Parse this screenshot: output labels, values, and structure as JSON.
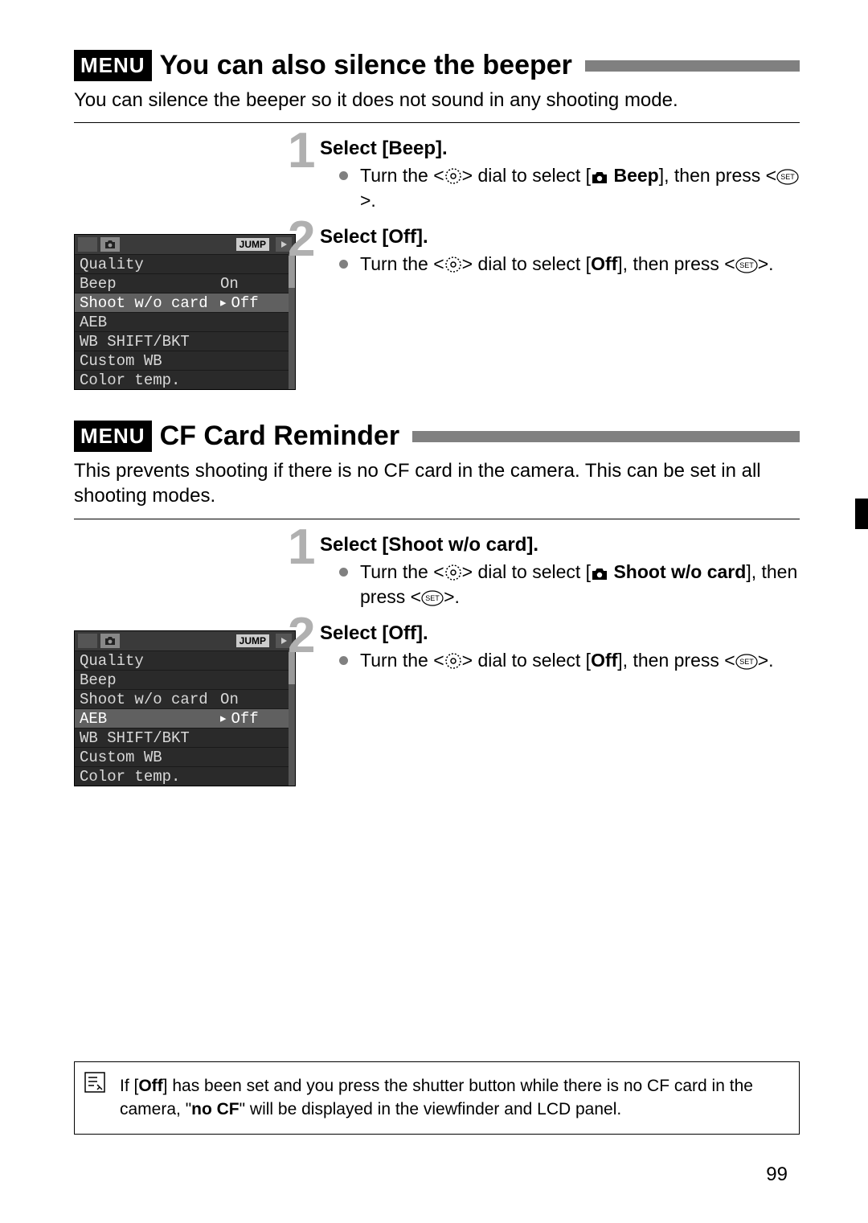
{
  "menu_badge": "MENU",
  "section1": {
    "title": "You can also silence the beeper",
    "intro": "You can silence the beeper so it does not sound in any shooting mode.",
    "step1": {
      "num": "1",
      "title": "Select [Beep].",
      "line_pre": "Turn the <",
      "line_mid": "> dial to select [",
      "line_bold": "Beep",
      "line_post1": "], then press <",
      "line_post2": ">."
    },
    "step2": {
      "num": "2",
      "title": "Select [Off].",
      "line_pre": "Turn the <",
      "line_mid": "> dial to select [",
      "line_bold": "Off",
      "line_post1": "], then press <",
      "line_post2": ">."
    }
  },
  "section2": {
    "title": "CF Card Reminder",
    "intro": "This prevents shooting if there is no CF card in the camera. This can be set in all shooting modes.",
    "step1": {
      "num": "1",
      "title": "Select [Shoot w/o card].",
      "line_pre": "Turn the <",
      "line_mid": "> dial to select [",
      "line_bold": "Shoot w/o card",
      "line_post1": "], then press <",
      "line_post2": ">."
    },
    "step2": {
      "num": "2",
      "title": "Select [Off].",
      "line_pre": "Turn the <",
      "line_mid": "> dial to select [",
      "line_bold": "Off",
      "line_post1": "], then press <",
      "line_post2": ">."
    }
  },
  "menu1": {
    "jump": "JUMP",
    "rows": [
      {
        "label": "Quality",
        "val": "",
        "hl": false,
        "arrow": ""
      },
      {
        "label": "Beep",
        "val": "On",
        "hl": false,
        "arrow": ""
      },
      {
        "label": "Shoot w/o card",
        "val": "Off",
        "hl": true,
        "arrow": "▸"
      },
      {
        "label": "AEB",
        "val": "",
        "hl": false,
        "arrow": ""
      },
      {
        "label": "WB SHIFT/BKT",
        "val": "",
        "hl": false,
        "arrow": ""
      },
      {
        "label": "Custom WB",
        "val": "",
        "hl": false,
        "arrow": ""
      },
      {
        "label": "Color temp.",
        "val": "",
        "hl": false,
        "arrow": ""
      }
    ]
  },
  "menu2": {
    "jump": "JUMP",
    "rows": [
      {
        "label": "Quality",
        "val": "",
        "hl": false,
        "arrow": ""
      },
      {
        "label": "Beep",
        "val": "",
        "hl": false,
        "arrow": ""
      },
      {
        "label": "Shoot w/o card",
        "val": "On",
        "hl": false,
        "arrow": ""
      },
      {
        "label": "AEB",
        "val": "Off",
        "hl": true,
        "arrow": "▸"
      },
      {
        "label": "WB SHIFT/BKT",
        "val": "",
        "hl": false,
        "arrow": ""
      },
      {
        "label": "Custom WB",
        "val": "",
        "hl": false,
        "arrow": ""
      },
      {
        "label": "Color temp.",
        "val": "",
        "hl": false,
        "arrow": ""
      }
    ]
  },
  "note": {
    "pre": "If [",
    "b1": "Off",
    "mid1": "] has been set and you press the shutter button while there is no CF card in the camera, \"",
    "b2": "no CF",
    "mid2": "\" will be displayed in the viewfinder and LCD panel."
  },
  "page": "99"
}
